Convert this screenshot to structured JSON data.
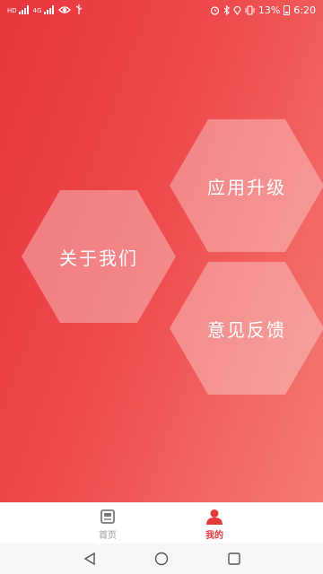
{
  "status_bar": {
    "battery_text": "13%",
    "time": "6:20",
    "icons": [
      "signal-icon",
      "signal-icon",
      "eye-icon",
      "usb-icon",
      "alarm-icon",
      "bluetooth-icon",
      "location-icon",
      "vibrate-icon",
      "battery-icon"
    ],
    "left_small_labels": [
      "HD",
      "4G"
    ]
  },
  "main": {
    "menu": [
      {
        "key": "about",
        "label": "关于我们"
      },
      {
        "key": "upgrade",
        "label": "应用升级"
      },
      {
        "key": "feedback",
        "label": "意见反馈"
      }
    ],
    "gradient_colors": [
      "#e8363d",
      "#f47a73"
    ]
  },
  "tabbar": {
    "items": [
      {
        "label": "首页",
        "icon": "book-icon",
        "active": false
      },
      {
        "label": "我的",
        "icon": "user-icon",
        "active": true
      }
    ],
    "active_color": "#e23a3a",
    "inactive_color": "#999999"
  },
  "nav": {
    "icons": [
      "back-triangle-icon",
      "home-circle-icon",
      "recent-square-icon"
    ]
  }
}
